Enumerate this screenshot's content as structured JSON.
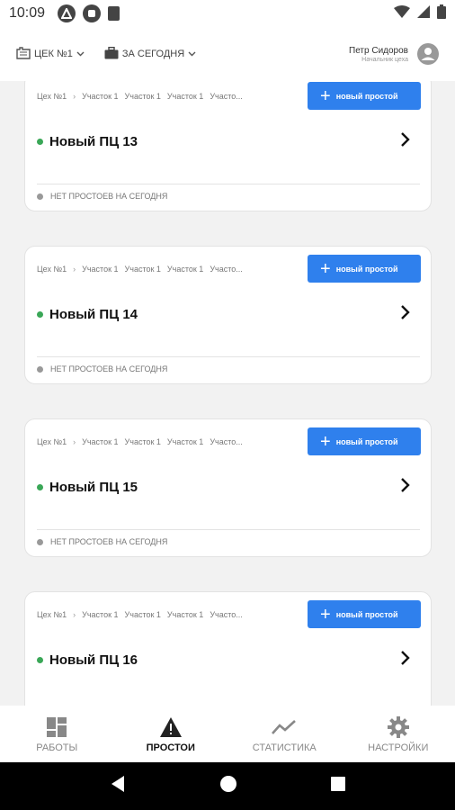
{
  "status_bar": {
    "time": "10:09"
  },
  "header": {
    "workshop_filter": "ЦЕК №1",
    "period_filter": "ЗА СЕГОДНЯ",
    "user_name": "Петр Сидоров",
    "user_role": "Начальник цеха"
  },
  "cards": [
    {
      "breadcrumb": [
        "Цех №1",
        "Участок 1",
        "Участок 1",
        "Участок 1",
        "Участо..."
      ],
      "button_label": "новый простой",
      "title": "Новый ПЦ 13",
      "status": "НЕТ ПРОСТОЕВ НА СЕГОДНЯ"
    },
    {
      "breadcrumb": [
        "Цех №1",
        "Участок 1",
        "Участок 1",
        "Участок 1",
        "Участо..."
      ],
      "button_label": "новый простой",
      "title": "Новый ПЦ 14",
      "status": "НЕТ ПРОСТОЕВ НА СЕГОДНЯ"
    },
    {
      "breadcrumb": [
        "Цех №1",
        "Участок 1",
        "Участок 1",
        "Участок 1",
        "Участо..."
      ],
      "button_label": "новый простой",
      "title": "Новый ПЦ 15",
      "status": "НЕТ ПРОСТОЕВ НА СЕГОДНЯ"
    },
    {
      "breadcrumb": [
        "Цех №1",
        "Участок 1",
        "Участок 1",
        "Участок 1",
        "Участо..."
      ],
      "button_label": "новый простой",
      "title": "Новый ПЦ 16",
      "status": ""
    }
  ],
  "bottom_nav": {
    "items": [
      {
        "label": "РАБОТЫ",
        "icon": "dashboard-icon"
      },
      {
        "label": "ПРОСТОИ",
        "icon": "warning-icon"
      },
      {
        "label": "СТАТИСТИКА",
        "icon": "trend-icon"
      },
      {
        "label": "НАСТРОЙКИ",
        "icon": "gear-icon"
      }
    ]
  },
  "colors": {
    "accent": "#2f80ed",
    "status_green": "#3aa757",
    "status_gray": "#999999"
  }
}
